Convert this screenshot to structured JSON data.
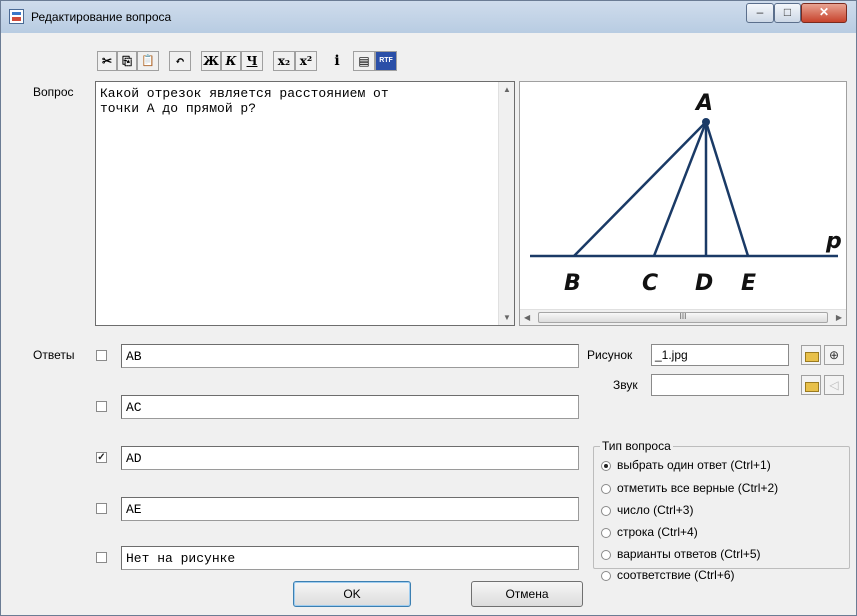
{
  "window": {
    "title": "Редактирование вопроса"
  },
  "window_controls": {
    "minimize": "–",
    "maximize": "□",
    "close": "✕"
  },
  "toolbar": [
    {
      "name": "cut-button",
      "glyph": "✂"
    },
    {
      "name": "copy-button",
      "glyph": "⎘"
    },
    {
      "name": "paste-button",
      "glyph": "📋"
    },
    {
      "name": "undo-button",
      "glyph": "↶"
    },
    {
      "name": "bold-button",
      "glyph": "Ж"
    },
    {
      "name": "italic-button",
      "glyph": "К"
    },
    {
      "name": "underline-button",
      "glyph": "Ч"
    },
    {
      "name": "subscript-button",
      "glyph": "x₂"
    },
    {
      "name": "superscript-button",
      "glyph": "x²"
    },
    {
      "name": "info-button",
      "glyph": "i"
    },
    {
      "name": "plain-text-button",
      "glyph": "▤"
    },
    {
      "name": "rtf-button",
      "glyph": "RTF"
    }
  ],
  "question": {
    "label": "Вопрос",
    "text": "Какой отрезок является расстоянием от\nточки А до прямой р?"
  },
  "figure": {
    "labels": {
      "apex": "A",
      "line": "p",
      "B": "B",
      "C": "C",
      "D": "D",
      "E": "E"
    },
    "stroke_color": "#1a3a66"
  },
  "answers": {
    "label": "Ответы",
    "items": [
      {
        "text": "AB",
        "checked": false
      },
      {
        "text": "AC",
        "checked": false
      },
      {
        "text": "AD",
        "checked": true
      },
      {
        "text": "AE",
        "checked": false
      },
      {
        "text": "Нет на рисунке",
        "checked": false
      }
    ]
  },
  "picture": {
    "label": "Рисунок",
    "value": "_1.jpg"
  },
  "sound": {
    "label": "Звук",
    "value": ""
  },
  "question_type": {
    "title": "Тип вопроса",
    "options": [
      {
        "label": "выбрать один ответ (Ctrl+1)",
        "selected": true
      },
      {
        "label": "отметить все верные (Ctrl+2)",
        "selected": false
      },
      {
        "label": "число (Ctrl+3)",
        "selected": false
      },
      {
        "label": "строка (Ctrl+4)",
        "selected": false
      },
      {
        "label": "варианты ответов (Ctrl+5)",
        "selected": false
      },
      {
        "label": "соответствие (Ctrl+6)",
        "selected": false
      }
    ]
  },
  "buttons": {
    "ok": "OK",
    "cancel": "Отмена"
  },
  "scroll": {
    "up": "▲",
    "down": "▼",
    "left": "◀",
    "right": "▶",
    "grip": "III"
  }
}
